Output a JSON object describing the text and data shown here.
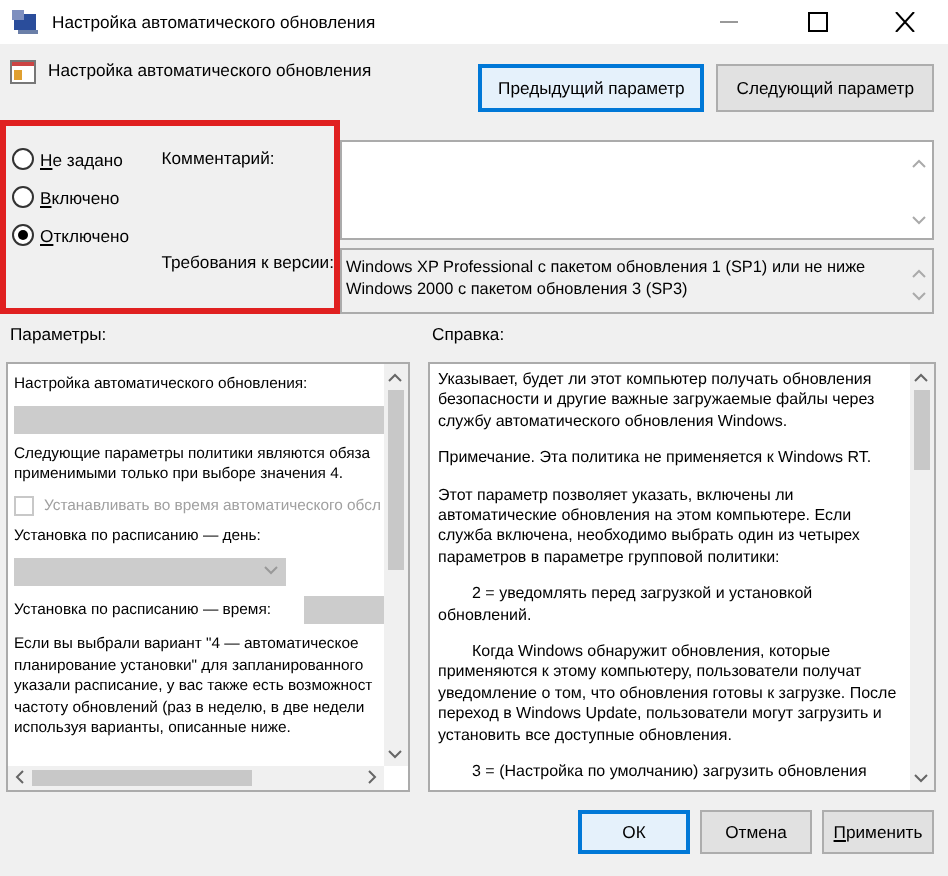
{
  "window": {
    "title": "Настройка автоматического обновления"
  },
  "header": {
    "title": "Настройка автоматического обновления",
    "nav_buttons": [
      {
        "label": "Предыдущий параметр",
        "focused": true
      },
      {
        "label": "Следующий параметр",
        "focused": false
      }
    ]
  },
  "state": {
    "highlighted": true,
    "options": [
      {
        "label": "Не задано",
        "selected": false
      },
      {
        "label": "Включено",
        "selected": false
      },
      {
        "label": "Отключено",
        "selected": true
      }
    ],
    "comment_label": "Комментарий:",
    "requirements_label": "Требования к версии:",
    "requirements": [
      "Windows XP Professional с пакетом обновления 1 (SP1) или не ниже",
      "Windows 2000 с пакетом обновления 3 (SP3)"
    ]
  },
  "options": {
    "label": "Параметры:",
    "items": [
      {
        "kind": "text",
        "lines": [
          "Настройка автоматического обновления:"
        ]
      },
      {
        "kind": "dropdown",
        "disabled": true
      },
      {
        "kind": "text",
        "lines": [
          "Следующие параметры политики являются обяза",
          "применимыми только при выборе значения 4."
        ]
      },
      {
        "kind": "checkbox",
        "label": "Устанавливать во время автоматического обсл",
        "checked": false,
        "disabled": true
      },
      {
        "kind": "text",
        "lines": [
          "Установка по расписанию — день:"
        ]
      },
      {
        "kind": "dropdown",
        "disabled": true
      },
      {
        "kind": "field",
        "label": "Установка по расписанию — время:",
        "disabled": true
      },
      {
        "kind": "text",
        "lines": [
          "Если вы выбрали вариант \"4 — автоматическое",
          "планирование установки\" для запланированного",
          "указали расписание, у вас также есть возможност",
          "частоту обновлений (раз в неделю, в две недели",
          "используя варианты, описанные ниже."
        ]
      }
    ]
  },
  "help": {
    "label": "Справка:",
    "paragraphs": [
      {
        "text": "Указывает, будет ли этот компьютер получать обновления безопасности и другие важные загружаемые файлы через службу автоматического обновления Windows.",
        "indented": false
      },
      {
        "text": "Примечание. Эта политика не применяется к Windows RT.",
        "indented": false
      },
      {
        "text": "Этот параметр позволяет указать, включены ли автоматические обновления на этом компьютере. Если служба включена, необходимо выбрать один из четырех параметров в параметре групповой политики:",
        "indented": false
      },
      {
        "text": "2 = уведомлять перед загрузкой и установкой обновлений.",
        "indented": true
      },
      {
        "text": "Когда Windows обнаружит обновления, которые применяются к этому компьютеру, пользователи получат уведомление о том, что обновления готовы к загрузке. После переход в Windows Update, пользователи могут загрузить и установить все доступные обновления.",
        "indented": true
      },
      {
        "text": "3 = (Настройка по умолчанию) загрузить обновления",
        "indented": true
      }
    ]
  },
  "footer_buttons": [
    {
      "label": "ОК",
      "focused": true
    },
    {
      "label": "Отмена",
      "focused": false
    },
    {
      "label": "Применить",
      "focused": false
    }
  ]
}
